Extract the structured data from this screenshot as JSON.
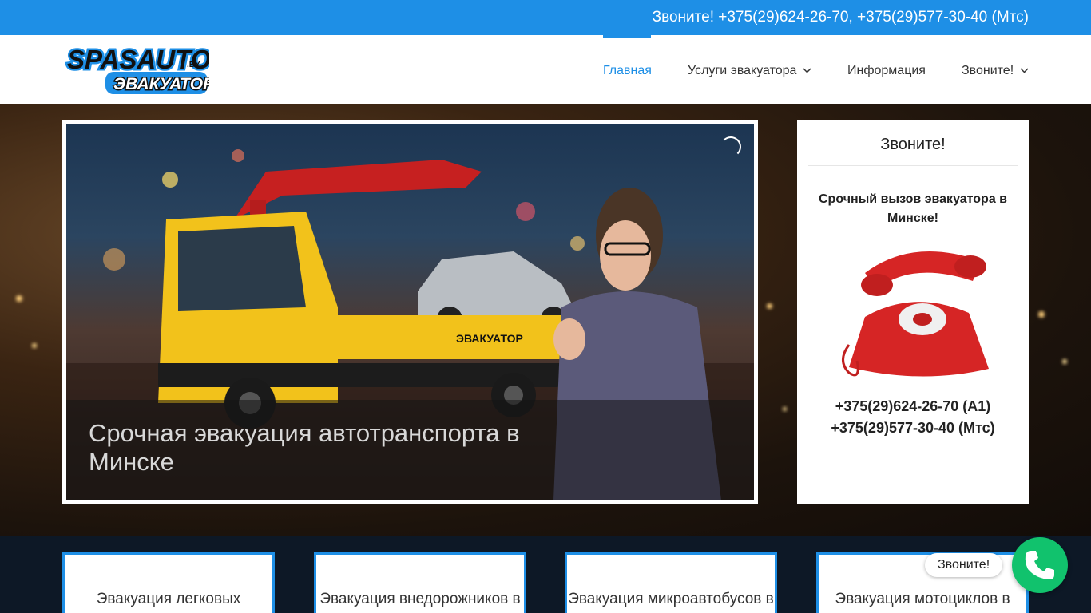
{
  "topbar": {
    "text": "Звоните! +375(29)624-26-70, +375(29)577-30-40 (Мтс)"
  },
  "header": {
    "logo_text_top": "SPASAUTO",
    "logo_text_by": ".BY",
    "logo_text_bottom": "ЭВАКУАТОР",
    "nav": [
      {
        "label": "Главная",
        "active": true
      },
      {
        "label": "Услуги эвакуатора",
        "has_dropdown": true
      },
      {
        "label": "Информация"
      },
      {
        "label": "Звоните!",
        "has_dropdown": true
      }
    ]
  },
  "slider": {
    "title": "Срочная эвакуация автотранспорта в Минске",
    "truck_label": "ЭВАКУАТОР"
  },
  "sidebar": {
    "title": "Звоните!",
    "text": "Срочный вызов эвакуатора в Минске!",
    "phone1": "+375(29)624-26-70 (А1)",
    "phone2": "+375(29)577-30-40 (Мтс)"
  },
  "cards": [
    {
      "label": "Эвакуация легковых автомобилей"
    },
    {
      "label": "Эвакуация внедорожников в Минске"
    },
    {
      "label": "Эвакуация микроавтобусов в Минске"
    },
    {
      "label": "Эвакуация мотоциклов в Минске"
    }
  ],
  "call_widget": {
    "label": "Звоните!"
  },
  "colors": {
    "accent": "#1e8fe6",
    "call_green": "#11c26d",
    "truck_yellow": "#f2c21b"
  }
}
